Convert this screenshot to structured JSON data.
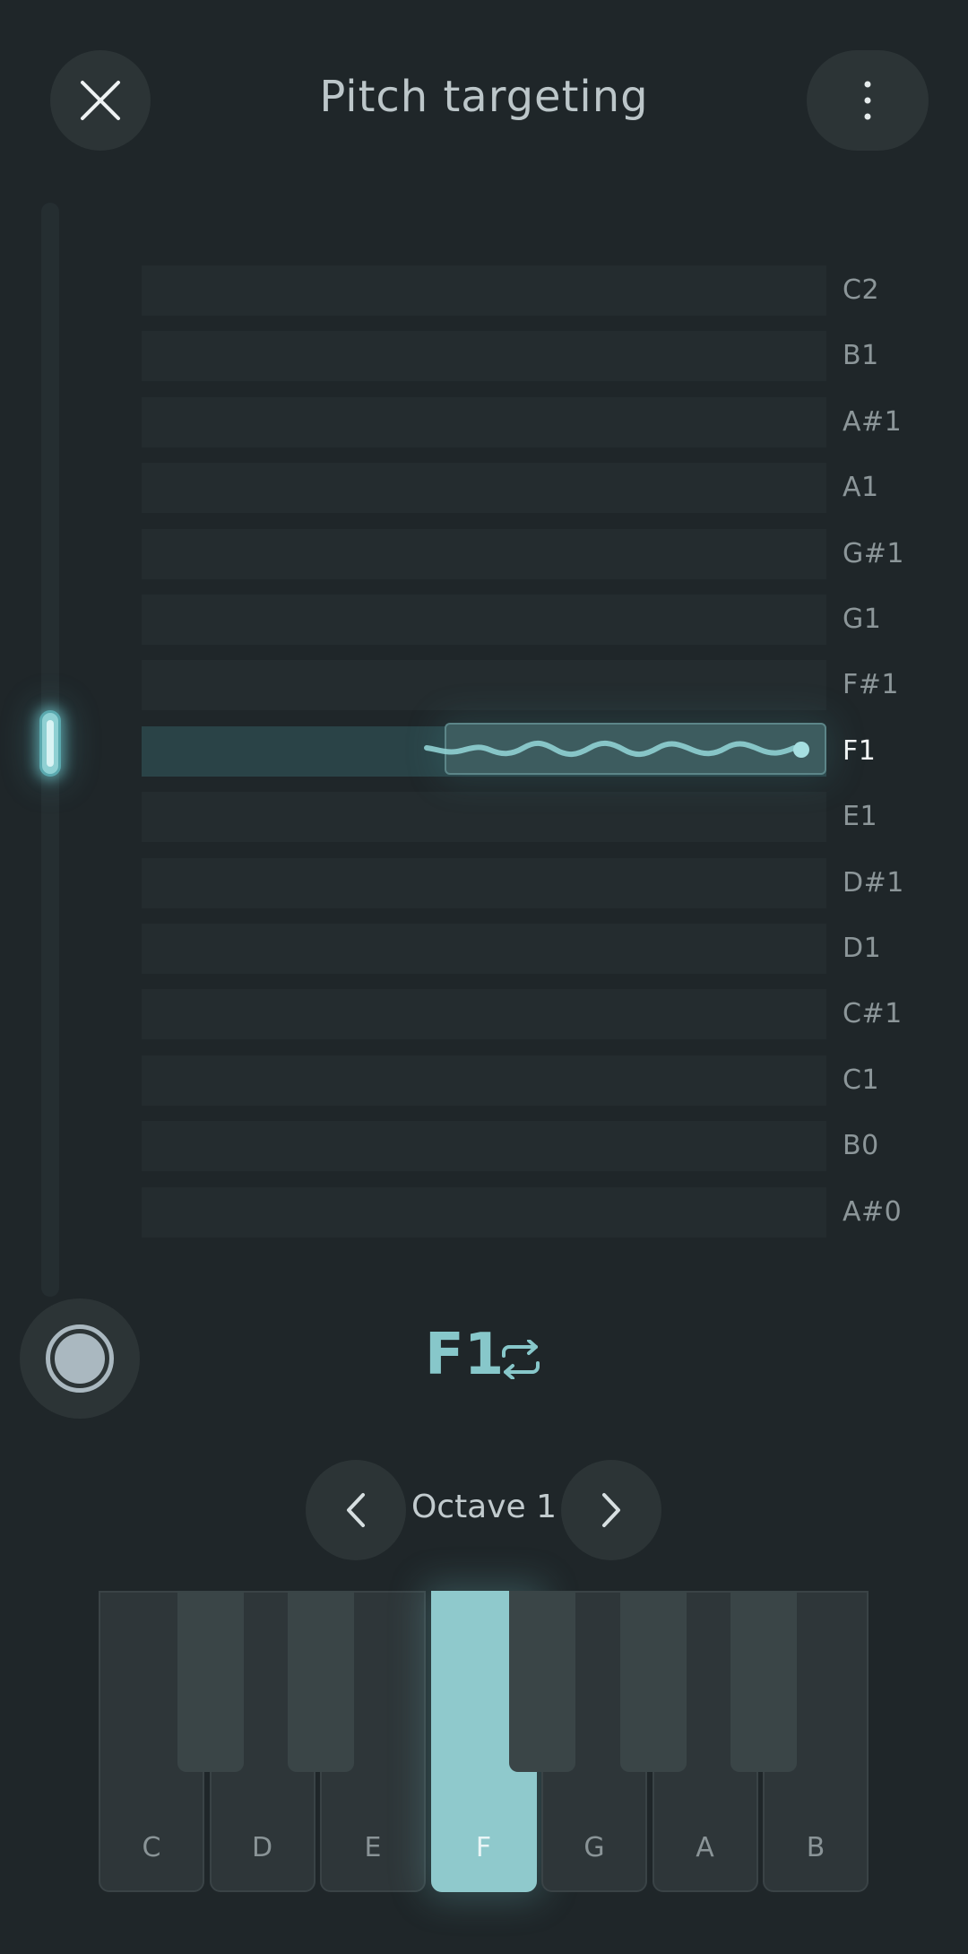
{
  "header": {
    "title": "Pitch targeting",
    "close_icon": "close-icon",
    "more_icon": "more-vertical-icon"
  },
  "notes": [
    "C2",
    "B1",
    "A#1",
    "A1",
    "G#1",
    "G1",
    "F#1",
    "F1",
    "E1",
    "D#1",
    "D1",
    "C#1",
    "C1",
    "B0",
    "A#0"
  ],
  "target_note": "F1",
  "current": {
    "note": "F1",
    "loop_icon": "repeat-icon"
  },
  "octave": {
    "label": "Octave 1",
    "prev_icon": "chevron-left-icon",
    "next_icon": "chevron-right-icon"
  },
  "keyboard": {
    "white_keys": [
      "C",
      "D",
      "E",
      "F",
      "G",
      "A",
      "B"
    ],
    "active_key": "F"
  },
  "record_icon": "record-icon",
  "colors": {
    "background": "#1f2629",
    "accent": "#8fc9cc",
    "row": "#242c2f"
  }
}
